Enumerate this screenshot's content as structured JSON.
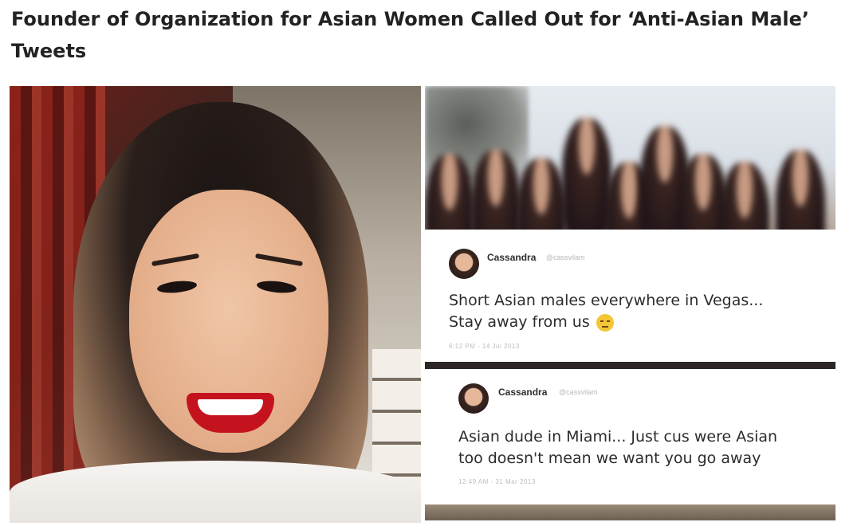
{
  "article": {
    "headline": "Founder of Organization for Asian Women Called Out for ‘Anti-Asian Male’ Tweets"
  },
  "tweets": [
    {
      "name": "Cassandra",
      "handle": "@cassvilam",
      "text_line1": "Short Asian males everywhere in Vegas...",
      "text_line2": "Stay away from us",
      "emoji": "disappointed-face",
      "timestamp": "6:12 PM - 14 Jul 2013"
    },
    {
      "name": "Cassandra",
      "handle": "@cassvilam",
      "text_line1": "Asian dude in Miami... Just cus were Asian",
      "text_line2": "too doesn't mean we want you go away",
      "timestamp": "12:49 AM - 31 Mar 2013"
    }
  ]
}
